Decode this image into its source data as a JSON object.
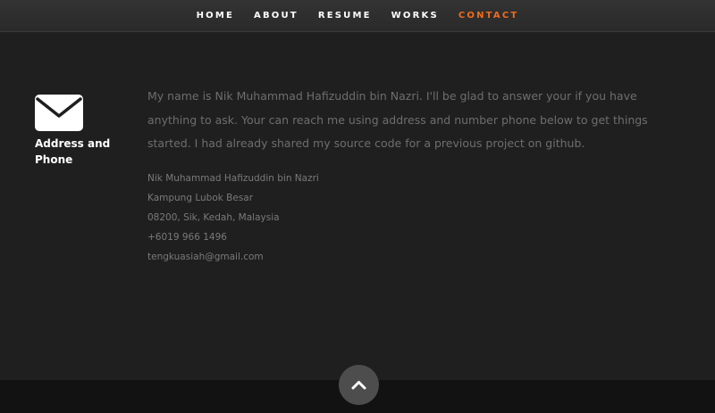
{
  "nav": {
    "items": [
      {
        "label": "HOME"
      },
      {
        "label": "ABOUT"
      },
      {
        "label": "RESUME"
      },
      {
        "label": "WORKS"
      },
      {
        "label": "CONTACT"
      }
    ],
    "active_item": "CONTACT",
    "active_color": "#f26b1d"
  },
  "contact": {
    "icon": "envelope-icon",
    "heading_line1": "Address and",
    "heading_line2": "Phone",
    "message_line1": "My name is Nik Muhammad Hafizuddin bin Nazri. I'll be glad to answer your if you have",
    "message_line2": "anything to ask. Your can reach me using address and number phone below to get things",
    "message_line3": "started. I had already shared my source code for a previous project on github.",
    "address": {
      "name": "Nik Muhammad Hafizuddin bin Nazri",
      "street": "Kampung Lubok Besar",
      "city": "08200, Sik, Kedah, Malaysia",
      "phone": "+6019 966 1496",
      "email": "tengkuasiah@gmail.com"
    }
  },
  "footer": {
    "back_to_top_icon": "chevron-up-icon"
  }
}
